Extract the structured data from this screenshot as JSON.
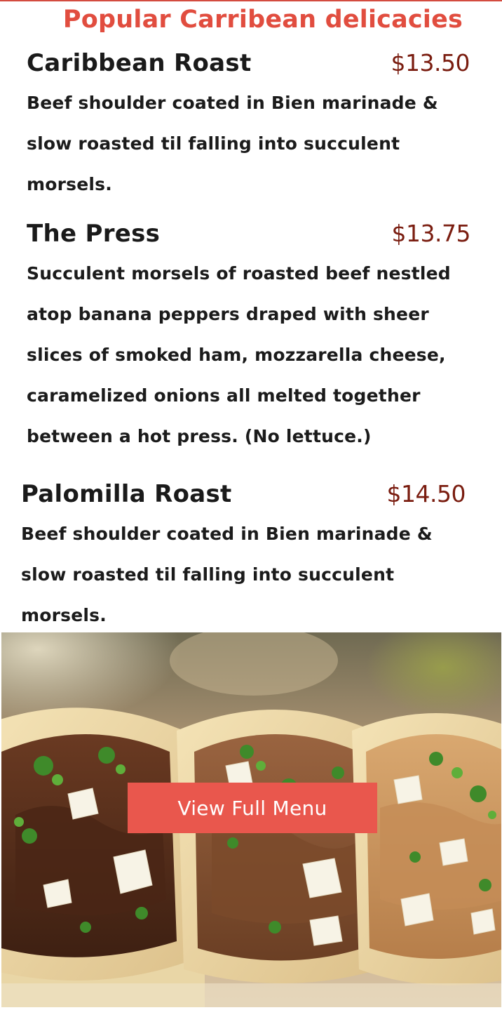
{
  "section": {
    "title": "Popular Carribean delicacies"
  },
  "menu_items": [
    {
      "name": "Caribbean Roast",
      "price": "$13.50",
      "description": "Beef shoulder coated in Bien marinade & slow roasted til falling into succulent morsels."
    },
    {
      "name": "The Press",
      "price": "$13.75",
      "description": "Succulent morsels of roasted beef nestled atop banana peppers draped with sheer slices of smoked ham, mozzarella cheese, caramelized onions all melted together between a hot press. (No lettuce.)"
    },
    {
      "name": "Palomilla Roast",
      "price": "$14.50",
      "description": "Beef shoulder coated in Bien marinade & slow roasted til falling into succulent morsels."
    }
  ],
  "hero": {
    "button_label": "View Full Menu"
  },
  "colors": {
    "accent": "#e14d3f",
    "price": "#7a1d10",
    "button": "#e9574d"
  }
}
